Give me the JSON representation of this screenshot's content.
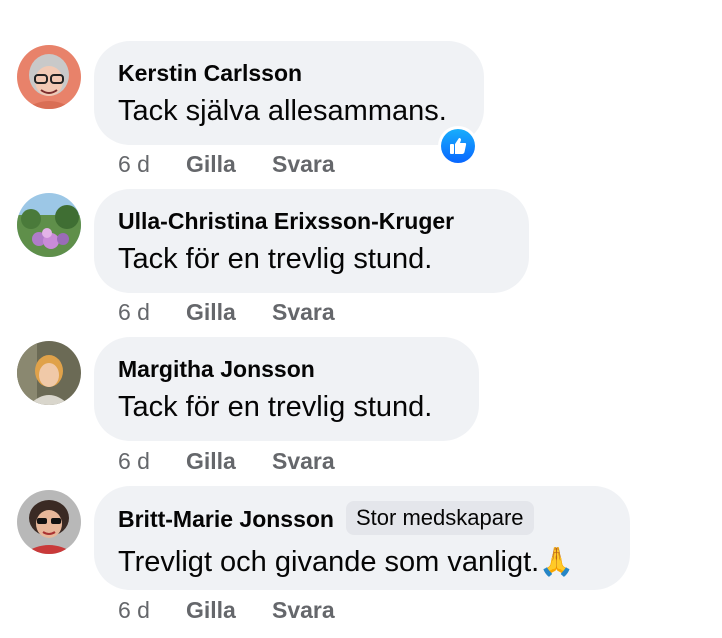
{
  "comments": [
    {
      "author": "Kerstin Carlsson",
      "text": "Tack själva allesammans.",
      "time": "6 d",
      "like_label": "Gilla",
      "reply_label": "Svara",
      "reaction_icon": "like-icon"
    },
    {
      "author": "Ulla-Christina Erixsson-Kruger",
      "text": "Tack för en trevlig stund.",
      "time": "6 d",
      "like_label": "Gilla",
      "reply_label": "Svara"
    },
    {
      "author": "Margitha Jonsson",
      "text": "Tack för en trevlig stund.",
      "time": "6 d",
      "like_label": "Gilla",
      "reply_label": "Svara"
    },
    {
      "author": "Britt-Marie Jonsson",
      "badge": "Stor medskapare",
      "text": "Trevligt och givande som vanligt.",
      "emoji": "🙏",
      "time": "6 d",
      "like_label": "Gilla",
      "reply_label": "Svara"
    }
  ],
  "colors": {
    "bubble": "#f0f2f5",
    "meta_text": "#65676b",
    "like_blue": "#0866ff",
    "badge_bg": "#e4e6eb"
  }
}
